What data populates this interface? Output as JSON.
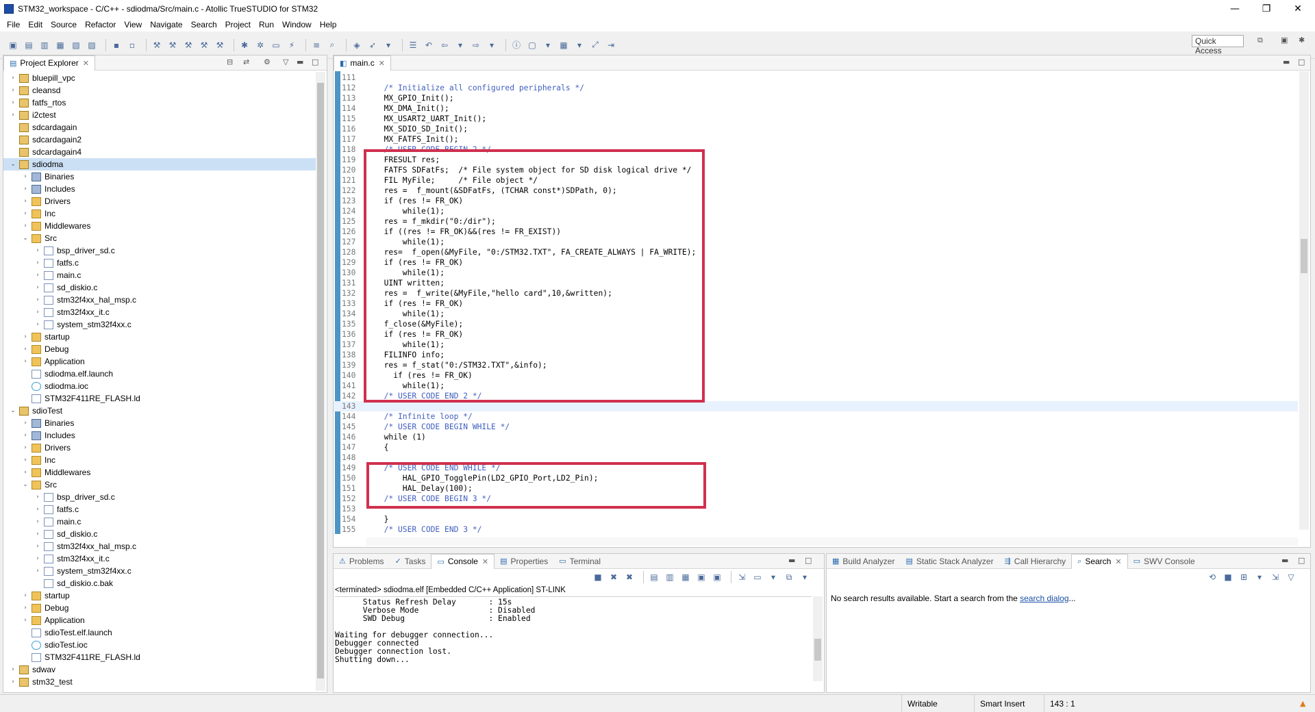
{
  "window": {
    "title": "STM32_workspace - C/C++ - sdiodma/Src/main.c - Atollic TrueSTUDIO for STM32",
    "minimize": "—",
    "maximize": "❐",
    "close": "✕"
  },
  "menu": [
    "File",
    "Edit",
    "Source",
    "Refactor",
    "View",
    "Navigate",
    "Search",
    "Project",
    "Run",
    "Window",
    "Help"
  ],
  "toolbar": {
    "quick_access": "Quick Access"
  },
  "explorer": {
    "tab_label": "Project Explorer",
    "tree": [
      {
        "label": "bluepill_vpc",
        "icon": "project",
        "indent": 0,
        "arrow": "›"
      },
      {
        "label": "cleansd",
        "icon": "project",
        "indent": 0,
        "arrow": "›"
      },
      {
        "label": "fatfs_rtos",
        "icon": "project",
        "indent": 0,
        "arrow": "›"
      },
      {
        "label": "i2ctest",
        "icon": "project",
        "indent": 0,
        "arrow": "›"
      },
      {
        "label": "sdcardagain",
        "icon": "project",
        "indent": 0,
        "arrow": ""
      },
      {
        "label": "sdcardagain2",
        "icon": "project",
        "indent": 0,
        "arrow": ""
      },
      {
        "label": "sdcardagain4",
        "icon": "project",
        "indent": 0,
        "arrow": ""
      },
      {
        "label": "sdiodma",
        "icon": "project",
        "indent": 0,
        "arrow": "⌄",
        "selected": true
      },
      {
        "label": "Binaries",
        "icon": "bin",
        "indent": 1,
        "arrow": "›"
      },
      {
        "label": "Includes",
        "icon": "bin",
        "indent": 1,
        "arrow": "›"
      },
      {
        "label": "Drivers",
        "icon": "folder",
        "indent": 1,
        "arrow": "›"
      },
      {
        "label": "Inc",
        "icon": "folder",
        "indent": 1,
        "arrow": "›"
      },
      {
        "label": "Middlewares",
        "icon": "folder",
        "indent": 1,
        "arrow": "›"
      },
      {
        "label": "Src",
        "icon": "folder",
        "indent": 1,
        "arrow": "⌄"
      },
      {
        "label": "bsp_driver_sd.c",
        "icon": "file",
        "indent": 2,
        "arrow": "›"
      },
      {
        "label": "fatfs.c",
        "icon": "file",
        "indent": 2,
        "arrow": "›"
      },
      {
        "label": "main.c",
        "icon": "file",
        "indent": 2,
        "arrow": "›"
      },
      {
        "label": "sd_diskio.c",
        "icon": "file",
        "indent": 2,
        "arrow": "›"
      },
      {
        "label": "stm32f4xx_hal_msp.c",
        "icon": "file",
        "indent": 2,
        "arrow": "›"
      },
      {
        "label": "stm32f4xx_it.c",
        "icon": "file",
        "indent": 2,
        "arrow": "›"
      },
      {
        "label": "system_stm32f4xx.c",
        "icon": "file",
        "indent": 2,
        "arrow": "›"
      },
      {
        "label": "startup",
        "icon": "folder",
        "indent": 1,
        "arrow": "›"
      },
      {
        "label": "Debug",
        "icon": "folder",
        "indent": 1,
        "arrow": "›"
      },
      {
        "label": "Application",
        "icon": "folder",
        "indent": 1,
        "arrow": "›"
      },
      {
        "label": "sdiodma.elf.launch",
        "icon": "file",
        "indent": 1,
        "arrow": ""
      },
      {
        "label": "sdiodma.ioc",
        "icon": "ioc",
        "indent": 1,
        "arrow": ""
      },
      {
        "label": "STM32F411RE_FLASH.ld",
        "icon": "file",
        "indent": 1,
        "arrow": ""
      },
      {
        "label": "sdioTest",
        "icon": "project",
        "indent": 0,
        "arrow": "⌄"
      },
      {
        "label": "Binaries",
        "icon": "bin",
        "indent": 1,
        "arrow": "›"
      },
      {
        "label": "Includes",
        "icon": "bin",
        "indent": 1,
        "arrow": "›"
      },
      {
        "label": "Drivers",
        "icon": "folder",
        "indent": 1,
        "arrow": "›"
      },
      {
        "label": "Inc",
        "icon": "folder",
        "indent": 1,
        "arrow": "›"
      },
      {
        "label": "Middlewares",
        "icon": "folder",
        "indent": 1,
        "arrow": "›"
      },
      {
        "label": "Src",
        "icon": "folder",
        "indent": 1,
        "arrow": "⌄"
      },
      {
        "label": "bsp_driver_sd.c",
        "icon": "file",
        "indent": 2,
        "arrow": "›"
      },
      {
        "label": "fatfs.c",
        "icon": "file",
        "indent": 2,
        "arrow": "›"
      },
      {
        "label": "main.c",
        "icon": "file",
        "indent": 2,
        "arrow": "›"
      },
      {
        "label": "sd_diskio.c",
        "icon": "file",
        "indent": 2,
        "arrow": "›"
      },
      {
        "label": "stm32f4xx_hal_msp.c",
        "icon": "file",
        "indent": 2,
        "arrow": "›"
      },
      {
        "label": "stm32f4xx_it.c",
        "icon": "file",
        "indent": 2,
        "arrow": "›"
      },
      {
        "label": "system_stm32f4xx.c",
        "icon": "file",
        "indent": 2,
        "arrow": "›"
      },
      {
        "label": "sd_diskio.c.bak",
        "icon": "file",
        "indent": 2,
        "arrow": ""
      },
      {
        "label": "startup",
        "icon": "folder",
        "indent": 1,
        "arrow": "›"
      },
      {
        "label": "Debug",
        "icon": "folder",
        "indent": 1,
        "arrow": "›"
      },
      {
        "label": "Application",
        "icon": "folder",
        "indent": 1,
        "arrow": "›"
      },
      {
        "label": "sdioTest.elf.launch",
        "icon": "file",
        "indent": 1,
        "arrow": ""
      },
      {
        "label": "sdioTest.ioc",
        "icon": "ioc",
        "indent": 1,
        "arrow": ""
      },
      {
        "label": "STM32F411RE_FLASH.ld",
        "icon": "file",
        "indent": 1,
        "arrow": ""
      },
      {
        "label": "sdwav",
        "icon": "project",
        "indent": 0,
        "arrow": "›"
      },
      {
        "label": "stm32_test",
        "icon": "project",
        "indent": 0,
        "arrow": "›"
      }
    ]
  },
  "editor": {
    "tab_label": "main.c",
    "lines": [
      {
        "n": "111",
        "t": ""
      },
      {
        "n": "112",
        "t": "  /* Initialize all configured peripherals */",
        "c": true
      },
      {
        "n": "113",
        "t": "  MX_GPIO_Init();"
      },
      {
        "n": "114",
        "t": "  MX_DMA_Init();"
      },
      {
        "n": "115",
        "t": "  MX_USART2_UART_Init();"
      },
      {
        "n": "116",
        "t": "  MX_SDIO_SD_Init();"
      },
      {
        "n": "117",
        "t": "  MX_FATFS_Init();"
      },
      {
        "n": "118",
        "t": "  /* USER CODE BEGIN 2 */",
        "c": true
      },
      {
        "n": "119",
        "t": "  FRESULT res;"
      },
      {
        "n": "120",
        "t": "  FATFS SDFatFs;  /* File system object for SD disk logical drive */"
      },
      {
        "n": "121",
        "t": "  FIL MyFile;     /* File object */"
      },
      {
        "n": "122",
        "t": "  res =  f_mount(&SDFatFs, (TCHAR const*)SDPath, 0);"
      },
      {
        "n": "123",
        "t": "  if (res != FR_OK)"
      },
      {
        "n": "124",
        "t": "      while(1);"
      },
      {
        "n": "125",
        "t": "  res = f_mkdir(\"0:/dir\");"
      },
      {
        "n": "126",
        "t": "  if ((res != FR_OK)&&(res != FR_EXIST))"
      },
      {
        "n": "127",
        "t": "      while(1);"
      },
      {
        "n": "128",
        "t": "  res=  f_open(&MyFile, \"0:/STM32.TXT\", FA_CREATE_ALWAYS | FA_WRITE);"
      },
      {
        "n": "129",
        "t": "  if (res != FR_OK)"
      },
      {
        "n": "130",
        "t": "      while(1);"
      },
      {
        "n": "131",
        "t": "  UINT written;"
      },
      {
        "n": "132",
        "t": "  res =  f_write(&MyFile,\"hello card\",10,&written);"
      },
      {
        "n": "133",
        "t": "  if (res != FR_OK)"
      },
      {
        "n": "134",
        "t": "      while(1);"
      },
      {
        "n": "135",
        "t": "  f_close(&MyFile);"
      },
      {
        "n": "136",
        "t": "  if (res != FR_OK)"
      },
      {
        "n": "137",
        "t": "      while(1);"
      },
      {
        "n": "138",
        "t": "  FILINFO info;"
      },
      {
        "n": "139",
        "t": "  res = f_stat(\"0:/STM32.TXT\",&info);"
      },
      {
        "n": "140",
        "t": "    if (res != FR_OK)"
      },
      {
        "n": "141",
        "t": "      while(1);"
      },
      {
        "n": "142",
        "t": "  /* USER CODE END 2 */",
        "c": true
      },
      {
        "n": "143",
        "t": "",
        "current": true
      },
      {
        "n": "144",
        "t": "  /* Infinite loop */",
        "c": true
      },
      {
        "n": "145",
        "t": "  /* USER CODE BEGIN WHILE */",
        "c": true
      },
      {
        "n": "146",
        "t": "  while (1)"
      },
      {
        "n": "147",
        "t": "  {"
      },
      {
        "n": "148",
        "t": ""
      },
      {
        "n": "149",
        "t": "  /* USER CODE END WHILE */",
        "c": true
      },
      {
        "n": "150",
        "t": "      HAL_GPIO_TogglePin(LD2_GPIO_Port,LD2_Pin);"
      },
      {
        "n": "151",
        "t": "      HAL_Delay(100);"
      },
      {
        "n": "152",
        "t": "  /* USER CODE BEGIN 3 */",
        "c": true
      },
      {
        "n": "153",
        "t": ""
      },
      {
        "n": "154",
        "t": "  }"
      },
      {
        "n": "155",
        "t": "  /* USER CODE END 3 */",
        "c": true
      }
    ]
  },
  "console": {
    "tabs": [
      "Problems",
      "Tasks",
      "Console",
      "Properties",
      "Terminal"
    ],
    "active_tab": "Console",
    "header": "<terminated> sdiodma.elf [Embedded C/C++ Application] ST-LINK",
    "lines": [
      "      Status Refresh Delay       : 15s",
      "      Verbose Mode               : Disabled",
      "      SWD Debug                  : Enabled",
      "",
      "Waiting for debugger connection...",
      "Debugger connected",
      "Debugger connection lost.",
      "Shutting down..."
    ]
  },
  "search": {
    "tabs": [
      "Build Analyzer",
      "Static Stack Analyzer",
      "Call Hierarchy",
      "Search",
      "SWV Console"
    ],
    "active_tab": "Search",
    "message_prefix": "No search results available. Start a search from the ",
    "message_link": "search dialog",
    "message_suffix": "..."
  },
  "status": {
    "writable": "Writable",
    "insert_mode": "Smart Insert",
    "position": "143 : 1"
  },
  "colors": {
    "highlight": "#d0304e",
    "comment": "#3f5fbf",
    "selection": "#cce0f5"
  }
}
